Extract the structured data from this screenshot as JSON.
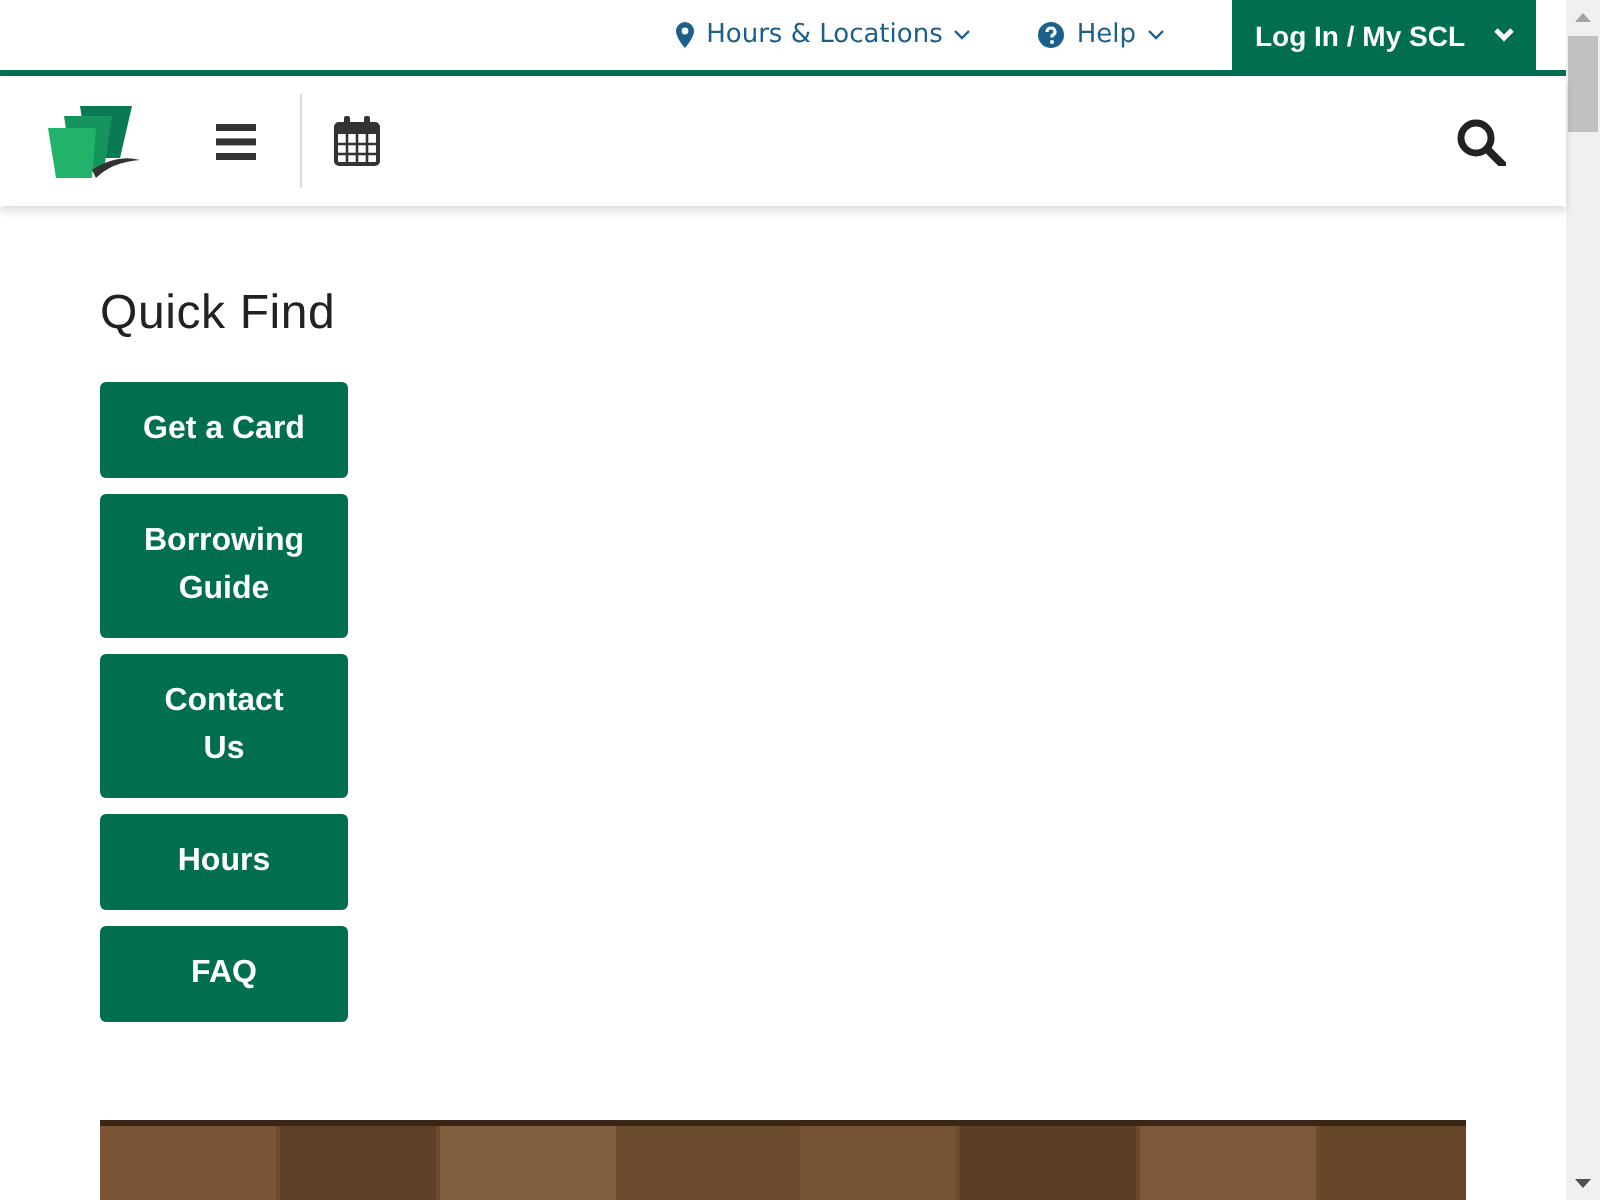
{
  "utility_nav": [
    {
      "label": "Hours & Locations"
    },
    {
      "label": "Help"
    }
  ],
  "account_button": {
    "label": "Log In / My SCL"
  },
  "quick_find": {
    "title": "Quick Find",
    "buttons": [
      "Get a Card",
      "Borrowing Guide",
      "Contact Us",
      "Hours",
      "FAQ"
    ]
  }
}
